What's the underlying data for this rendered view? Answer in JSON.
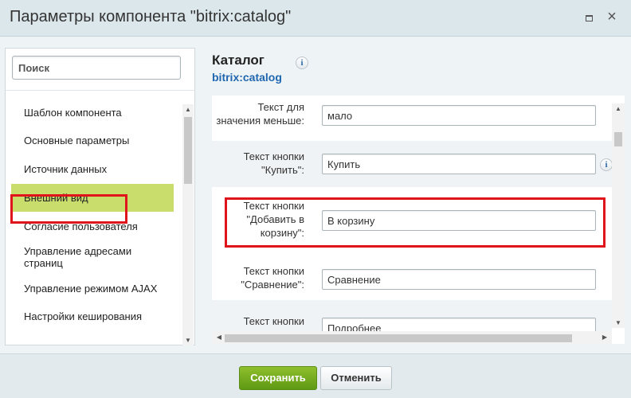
{
  "dialog": {
    "title": "Параметры компонента \"bitrix:catalog\"",
    "maximize_symbol": "",
    "close_symbol": "×"
  },
  "sidebar": {
    "search_placeholder": "Поиск",
    "items": [
      {
        "label": "Шаблон компонента",
        "active": false
      },
      {
        "label": "Основные параметры",
        "active": false
      },
      {
        "label": "Источник данных",
        "active": false
      },
      {
        "label": "Внешний вид",
        "active": true
      },
      {
        "label": "Согласие пользователя",
        "active": false
      },
      {
        "label": "Управление адресами страниц",
        "active": false
      },
      {
        "label": "Управление режимом AJAX",
        "active": false
      },
      {
        "label": "Настройки кеширования",
        "active": false
      }
    ]
  },
  "main": {
    "title": "Каталог",
    "subtitle": "bitrix:catalog",
    "info_symbol": "i",
    "params": [
      {
        "label": "Текст для значения меньше:",
        "value": "мало"
      },
      {
        "label": "Текст кнопки \"Купить\":",
        "value": "Купить"
      },
      {
        "label": "Текст кнопки \"Добавить в корзину\":",
        "value": "В корзину"
      },
      {
        "label": "Текст кнопки \"Сравнение\":",
        "value": "Сравнение"
      },
      {
        "label": "Текст кнопки",
        "value": "Подробнее"
      }
    ]
  },
  "footer": {
    "save_label": "Сохранить",
    "cancel_label": "Отменить"
  },
  "colors": {
    "active_item_bg": "#c9dd6d",
    "highlight_border": "#e0151b",
    "save_button": "#6aa51a",
    "subtitle_link": "#2067b0"
  }
}
